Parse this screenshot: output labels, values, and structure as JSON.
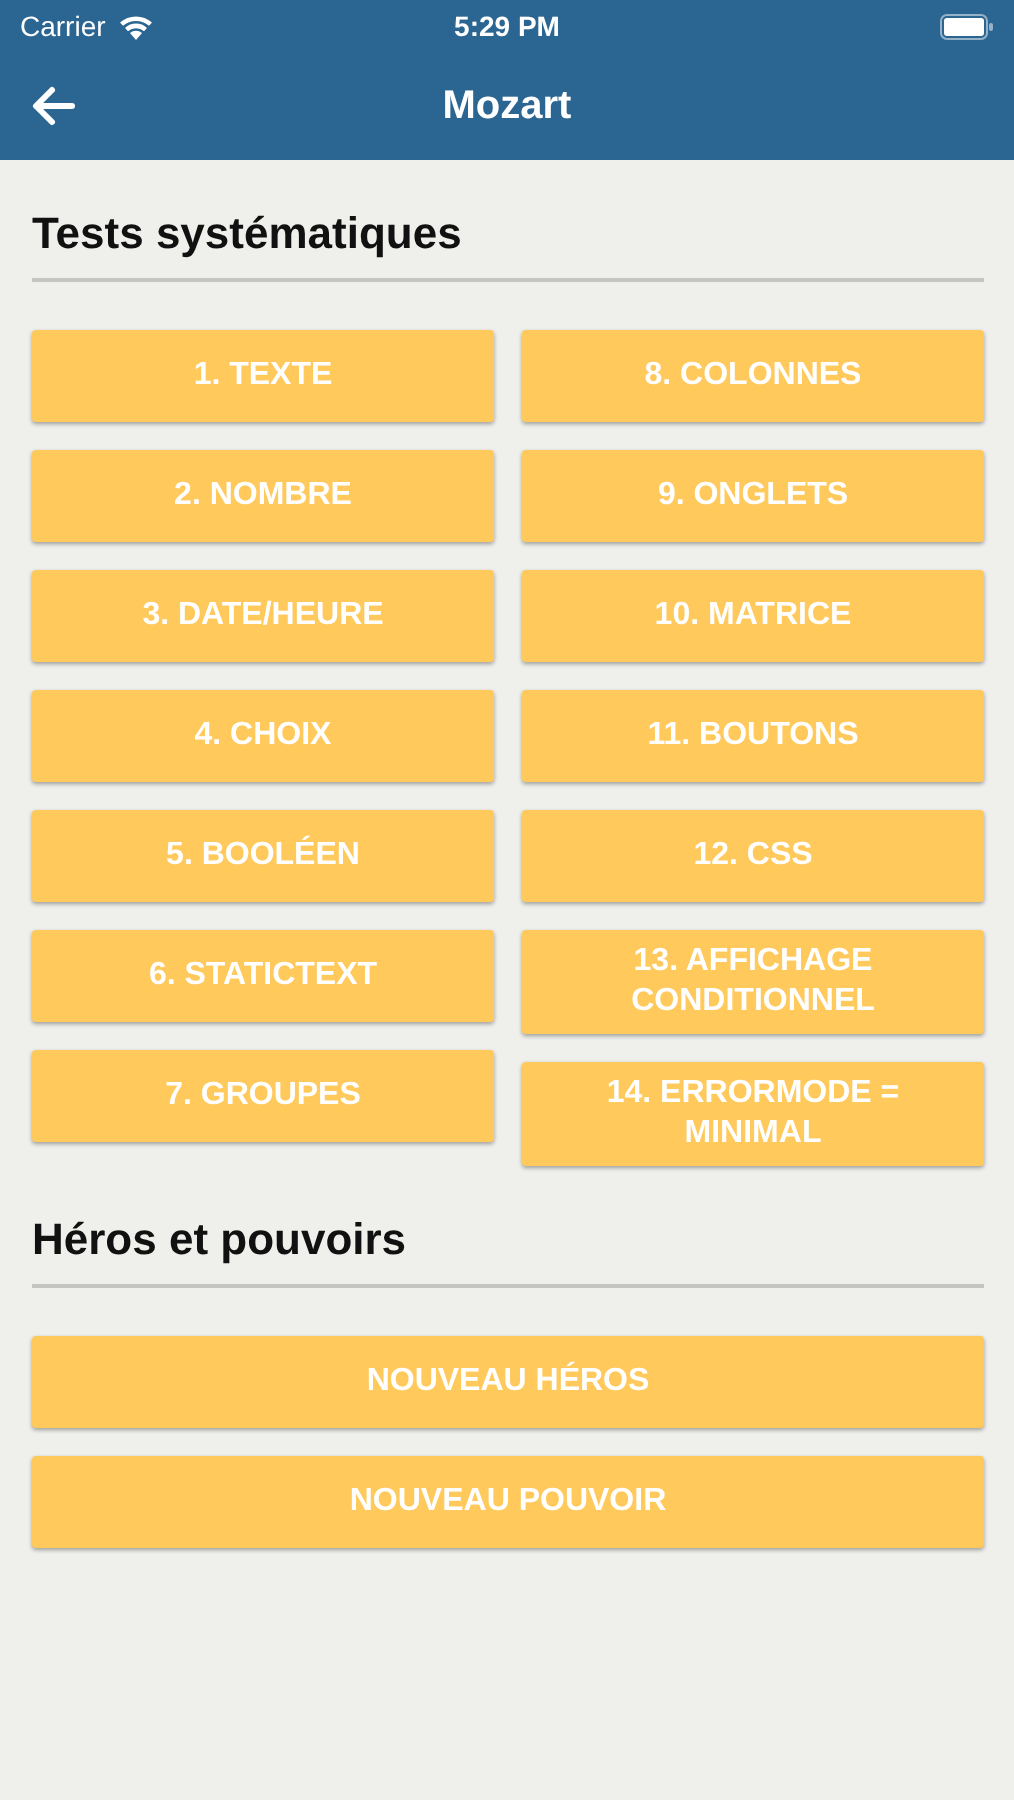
{
  "status_bar": {
    "carrier": "Carrier",
    "time": "5:29 PM"
  },
  "nav_bar": {
    "title": "Mozart"
  },
  "sections": [
    {
      "kind": "columns",
      "title": "Tests systématiques",
      "columns": [
        [
          "1. TEXTE",
          "2. NOMBRE",
          "3. DATE/HEURE",
          "4. CHOIX",
          "5. BOOLÉEN",
          "6. STATICTEXT",
          "7. GROUPES"
        ],
        [
          "8. COLONNES",
          "9. ONGLETS",
          "10. MATRICE",
          "11. BOUTONS",
          "12. CSS",
          "13. AFFICHAGE CONDITIONNEL",
          "14. ERRORMODE = MINIMAL"
        ]
      ]
    },
    {
      "kind": "list",
      "title": "Héros et pouvoirs",
      "buttons": [
        "NOUVEAU HÉROS",
        "NOUVEAU POUVOIR"
      ]
    }
  ]
}
